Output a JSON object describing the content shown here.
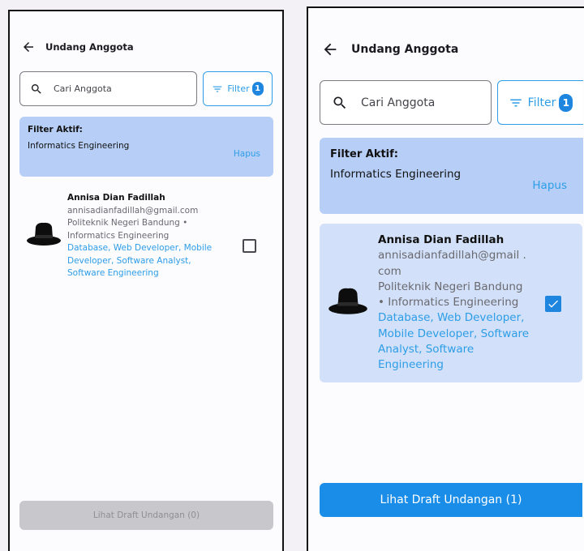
{
  "screens": [
    {
      "header": {
        "title": "Undang Anggota"
      },
      "search": {
        "placeholder": "Cari Anggota"
      },
      "filter": {
        "label": "Filter",
        "badge": "1"
      },
      "active_filter": {
        "title": "Filter Aktif:",
        "value": "Informatics Engineering",
        "clear": "Hapus"
      },
      "member": {
        "name": "Annisa Dian Fadillah",
        "email": "annisadianfadillah@gmail.com",
        "school": "Politeknik Negeri Bandung • Informatics Engineering",
        "skills": "Database, Web Developer, Mobile Developer, Software Analyst, Software Engineering",
        "selected": false
      },
      "draft_button": {
        "label": "Lihat Draft Undangan (0)",
        "enabled": false
      }
    },
    {
      "header": {
        "title": "Undang Anggota"
      },
      "search": {
        "placeholder": "Cari Anggota"
      },
      "filter": {
        "label": "Filter",
        "badge": "1"
      },
      "active_filter": {
        "title": "Filter Aktif:",
        "value": "Informatics Engineering",
        "clear": "Hapus"
      },
      "member": {
        "name": "Annisa Dian Fadillah",
        "email": "annisadianfadillah@gmail .com",
        "school": "Politeknik Negeri Bandung • Informatics Engineering",
        "skills": "Database, Web Developer, Mobile Developer, Software Analyst, Software Engineering",
        "selected": true
      },
      "draft_button": {
        "label": "Lihat Draft Undangan (1)",
        "enabled": true
      }
    }
  ],
  "colors": {
    "accent": "#2d9de7",
    "primary_button": "#1a8de8",
    "filter_panel": "#b7cff7",
    "selected_card": "#d2e1f9",
    "disabled_button": "#c8c7cc"
  }
}
